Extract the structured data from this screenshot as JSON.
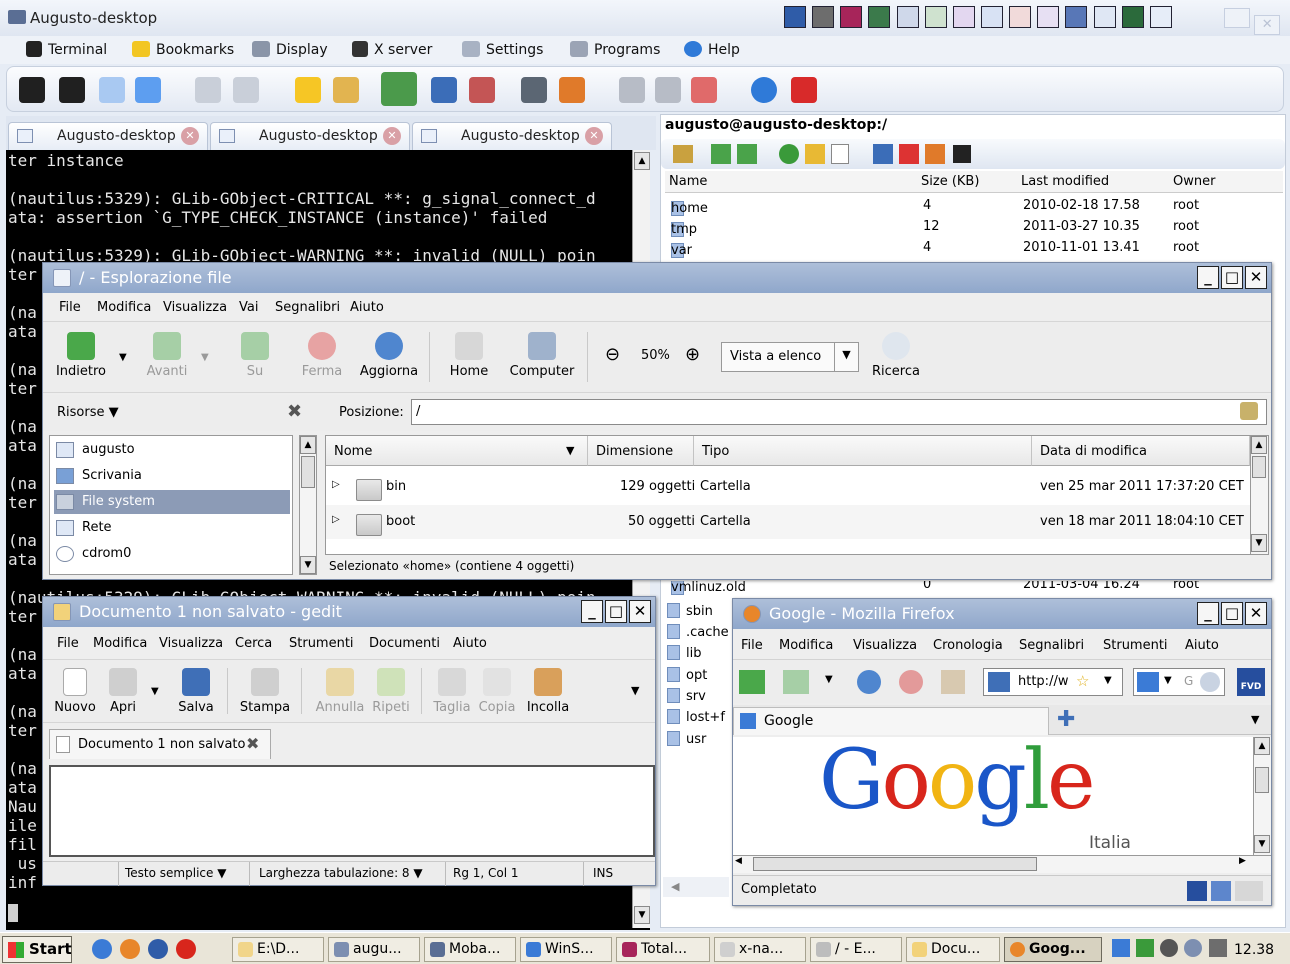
{
  "moba": {
    "title": "Augusto-desktop",
    "menu": [
      "Terminal",
      "Bookmarks",
      "Display",
      "X server",
      "Settings",
      "Programs",
      "Help"
    ],
    "tabs": [
      "Augusto-desktop",
      "Augusto-desktop",
      "Augusto-desktop"
    ],
    "terminal_lines": [
      "ter instance",
      "",
      "(nautilus:5329): GLib-GObject-CRITICAL **: g_signal_connect_d",
      "ata: assertion `G_TYPE_CHECK_INSTANCE (instance)' failed",
      "",
      "(nautilus:5329): GLib-GObject-WARNING **: invalid (NULL) poin",
      "ter",
      "",
      "(na",
      "ata",
      "",
      "(na",
      "ter",
      "",
      "(na",
      "ata",
      "",
      "(na",
      "ter",
      "",
      "(na",
      "ata",
      "",
      "(nautilus:5329): GLib-GObject-WARNING **: invalid (NULL) poin",
      "ter",
      "",
      "(na",
      "ata",
      "",
      "(na",
      "ter",
      "",
      "(na",
      "ata",
      "Nau",
      "ile",
      "fil",
      " us",
      "inf"
    ]
  },
  "sftp": {
    "path": "augusto@augusto-desktop:/",
    "columns": [
      "Name",
      "Size (KB)",
      "Last modified",
      "Owner"
    ],
    "rows": [
      {
        "name": "home",
        "size": "4",
        "modified": "2010-02-18 17.58",
        "owner": "root"
      },
      {
        "name": "tmp",
        "size": "12",
        "modified": "2011-03-27 10.35",
        "owner": "root"
      },
      {
        "name": "var",
        "size": "4",
        "modified": "2010-11-01 13.41",
        "owner": "root"
      }
    ],
    "partial_row": {
      "name": "vmlinuz.old",
      "size": "0",
      "modified": "2011-03-04 16.24",
      "owner": "root"
    },
    "left_items": [
      "sbin",
      ".cache",
      "lib",
      "opt",
      "srv",
      "lost+f",
      "usr"
    ]
  },
  "nautilus": {
    "title": "/ - Esplorazione file",
    "menu": [
      "File",
      "Modifica",
      "Visualizza",
      "Vai",
      "Segnalibri",
      "Aiuto"
    ],
    "toolbar": {
      "back": "Indietro",
      "forward": "Avanti",
      "up": "Su",
      "stop": "Ferma",
      "reload": "Aggiorna",
      "home": "Home",
      "computer": "Computer",
      "zoom": "50%",
      "view_mode": "Vista a elenco",
      "search": "Ricerca"
    },
    "places_label": "Risorse",
    "location_label": "Posizione:",
    "location_value": "/",
    "places": [
      "augusto",
      "Scrivania",
      "File system",
      "Rete",
      "cdrom0"
    ],
    "columns": [
      "Nome",
      "Dimensione",
      "Tipo",
      "Data di modifica"
    ],
    "files": [
      {
        "name": "bin",
        "size": "129 oggetti",
        "type": "Cartella",
        "date": "ven 25 mar 2011 17:37:20 CET"
      },
      {
        "name": "boot",
        "size": "50 oggetti",
        "type": "Cartella",
        "date": "ven 18 mar 2011 18:04:10 CET"
      }
    ],
    "status": "Selezionato «home» (contiene 4 oggetti)"
  },
  "gedit": {
    "title": "Documento 1 non salvato - gedit",
    "menu": [
      "File",
      "Modifica",
      "Visualizza",
      "Cerca",
      "Strumenti",
      "Documenti",
      "Aiuto"
    ],
    "toolbar": {
      "new": "Nuovo",
      "open": "Apri",
      "save": "Salva",
      "print": "Stampa",
      "undo": "Annulla",
      "redo": "Ripeti",
      "cut": "Taglia",
      "copy": "Copia",
      "paste": "Incolla"
    },
    "tab": "Documento 1 non salvato",
    "status": {
      "mode": "Testo semplice",
      "tab_width": "Larghezza tabulazione:  8",
      "position": "Rg 1, Col 1",
      "ins": "INS"
    }
  },
  "firefox": {
    "title": "Google - Mozilla Firefox",
    "menu": [
      "File",
      "Modifica",
      "Visualizza",
      "Cronologia",
      "Segnalibri",
      "Strumenti",
      "Aiuto"
    ],
    "url": "http://w",
    "search": "G",
    "tab": "Google",
    "logo_sub": "Italia",
    "status": "Completato"
  },
  "taskbar": {
    "start": "Start",
    "tasks": [
      "E:\\D...",
      "augu...",
      "Moba...",
      "WinS...",
      "Total...",
      "x-na...",
      "/ - E...",
      "Docu...",
      "Goog..."
    ],
    "clock": "12.38"
  }
}
